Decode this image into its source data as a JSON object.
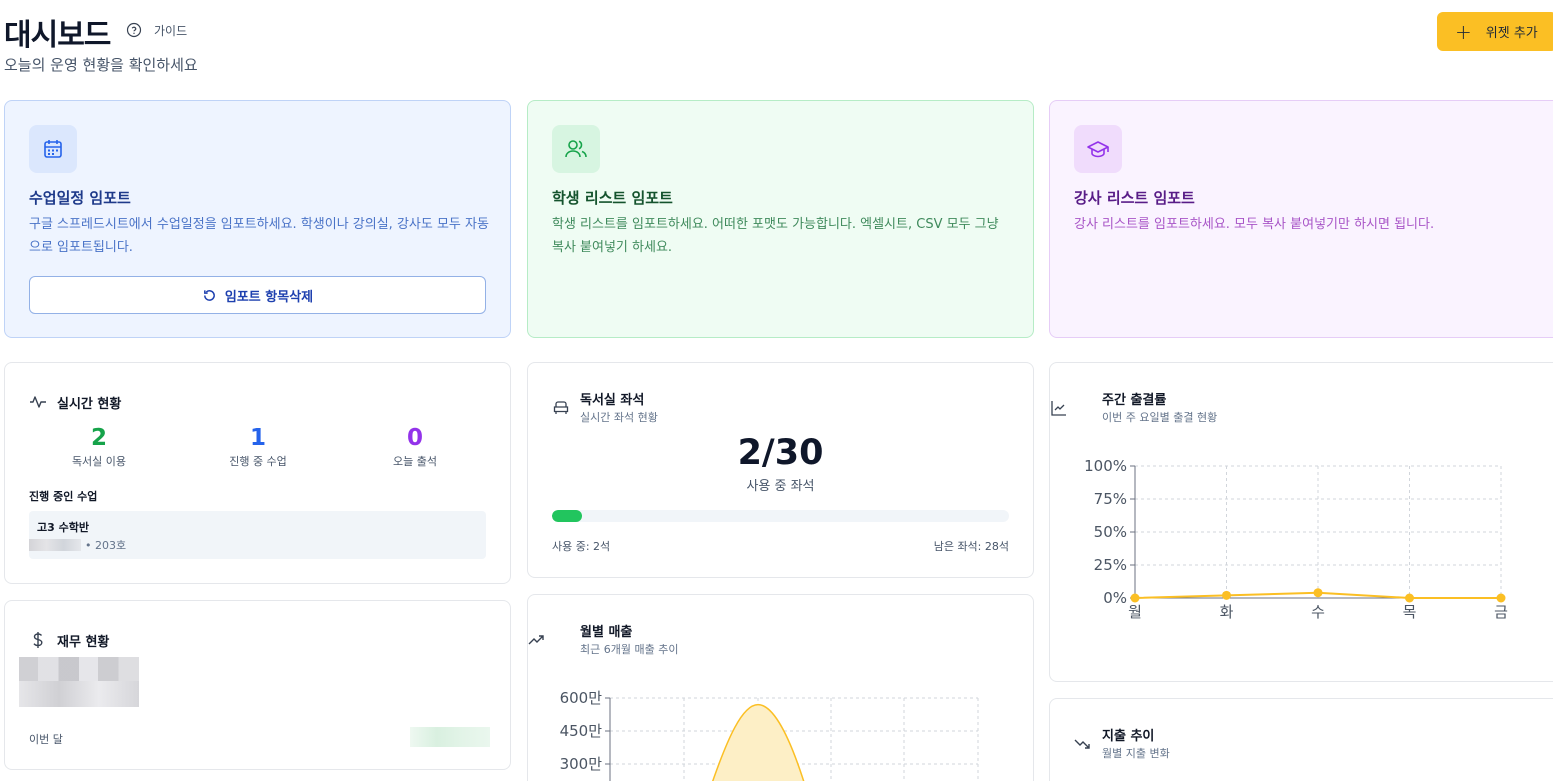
{
  "header": {
    "title": "대시보드",
    "guide": "가이드",
    "subtitle": "오늘의 운영 현황을 확인하세요",
    "add_widget": "위젯 추가"
  },
  "import_cards": [
    {
      "title": "수업일정 임포트",
      "desc": "구글 스프레드시트에서 수업일정을 임포트하세요. 학생이나 강의실, 강사도 모두 자동으로 임포트됩니다.",
      "button": "임포트 항목삭제",
      "icon": "calendar-icon"
    },
    {
      "title": "학생 리스트 임포트",
      "desc": "학생 리스트를 임포트하세요. 어떠한 포맷도 가능합니다. 엑셀시트, CSV 모두 그냥 복사 붙여넣기 하세요.",
      "icon": "users-icon"
    },
    {
      "title": "강사 리스트 임포트",
      "desc": "강사 리스트를 임포트하세요. 모두 복사 붙여넣기만 하시면 됩니다.",
      "icon": "graduation-cap-icon"
    }
  ],
  "realtime": {
    "title": "실시간 현황",
    "stats": [
      {
        "value": "2",
        "label": "독서실 이용",
        "color": "#16a34a"
      },
      {
        "value": "1",
        "label": "진행 중 수업",
        "color": "#2563eb"
      },
      {
        "value": "0",
        "label": "오늘 출석",
        "color": "#9333ea"
      }
    ],
    "ongoing_label": "진행 중인 수업",
    "ongoing_class": {
      "name": "고3 수학반",
      "room": "• 203호"
    }
  },
  "finance": {
    "title": "재무 현황",
    "period": "이번 달"
  },
  "seats": {
    "title": "독서실 좌석",
    "subtitle": "실시간 좌석 현황",
    "display": "2/30",
    "used": 2,
    "total": 30,
    "label": "사용 중 좌석",
    "used_text": "사용 중: 2석",
    "left_text": "남은 좌석: 28석"
  },
  "monthly": {
    "title": "월별 매출",
    "subtitle": "최근 6개월 매출 추이"
  },
  "weekly": {
    "title": "주간 출결률",
    "subtitle": "이번 주 요일별 출결 현황"
  },
  "expense": {
    "title": "지출 추이",
    "subtitle": "월별 지출 변화"
  },
  "chart_data": [
    {
      "type": "line",
      "categories": [
        "월",
        "화",
        "수",
        "목",
        "금"
      ],
      "values": [
        0,
        2,
        4,
        0,
        0
      ],
      "ylim": [
        0,
        100
      ],
      "yticks": [
        "0%",
        "25%",
        "50%",
        "75%",
        "100%"
      ],
      "color": "#fbbf24",
      "grid": true
    },
    {
      "type": "area",
      "yticks": [
        "300만",
        "450만",
        "600만"
      ],
      "ylim": [
        0,
        600
      ],
      "peak": 570,
      "color": "#fbbf24",
      "grid": true
    }
  ]
}
